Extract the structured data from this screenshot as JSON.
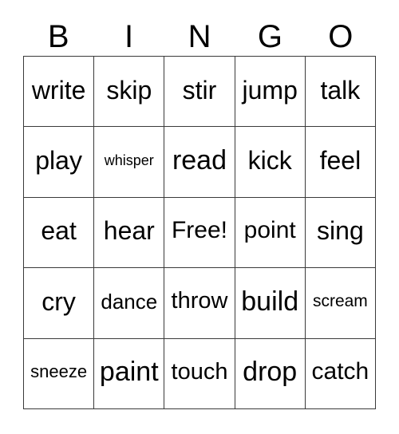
{
  "card": {
    "header_letters": [
      "B",
      "I",
      "N",
      "G",
      "O"
    ],
    "columns": 5,
    "rows": 5,
    "border_color": "#3a3a3a",
    "background_color": "#ffffff",
    "text_color": "#000000",
    "free_space_label": "Free!",
    "cells": [
      [
        {
          "label": "write",
          "size": "xl"
        },
        {
          "label": "skip",
          "size": "xl"
        },
        {
          "label": "stir",
          "size": "xl"
        },
        {
          "label": "jump",
          "size": "xl"
        },
        {
          "label": "talk",
          "size": "xl"
        }
      ],
      [
        {
          "label": "play",
          "size": "xl"
        },
        {
          "label": "whisper",
          "size": "xs"
        },
        {
          "label": "read",
          "size": "xxl"
        },
        {
          "label": "kick",
          "size": "xl"
        },
        {
          "label": "feel",
          "size": "xl"
        }
      ],
      [
        {
          "label": "eat",
          "size": "xl"
        },
        {
          "label": "hear",
          "size": "xl"
        },
        {
          "label": "Free!",
          "size": "l"
        },
        {
          "label": "point",
          "size": "l"
        },
        {
          "label": "sing",
          "size": "xl"
        }
      ],
      [
        {
          "label": "cry",
          "size": "xl"
        },
        {
          "label": "dance",
          "size": "m"
        },
        {
          "label": "throw",
          "size": "ml"
        },
        {
          "label": "build",
          "size": "xxl"
        },
        {
          "label": "scream",
          "size": "s"
        }
      ],
      [
        {
          "label": "sneeze",
          "size": "sm"
        },
        {
          "label": "paint",
          "size": "xxl"
        },
        {
          "label": "touch",
          "size": "ml"
        },
        {
          "label": "drop",
          "size": "xxl"
        },
        {
          "label": "catch",
          "size": "l"
        }
      ]
    ]
  }
}
